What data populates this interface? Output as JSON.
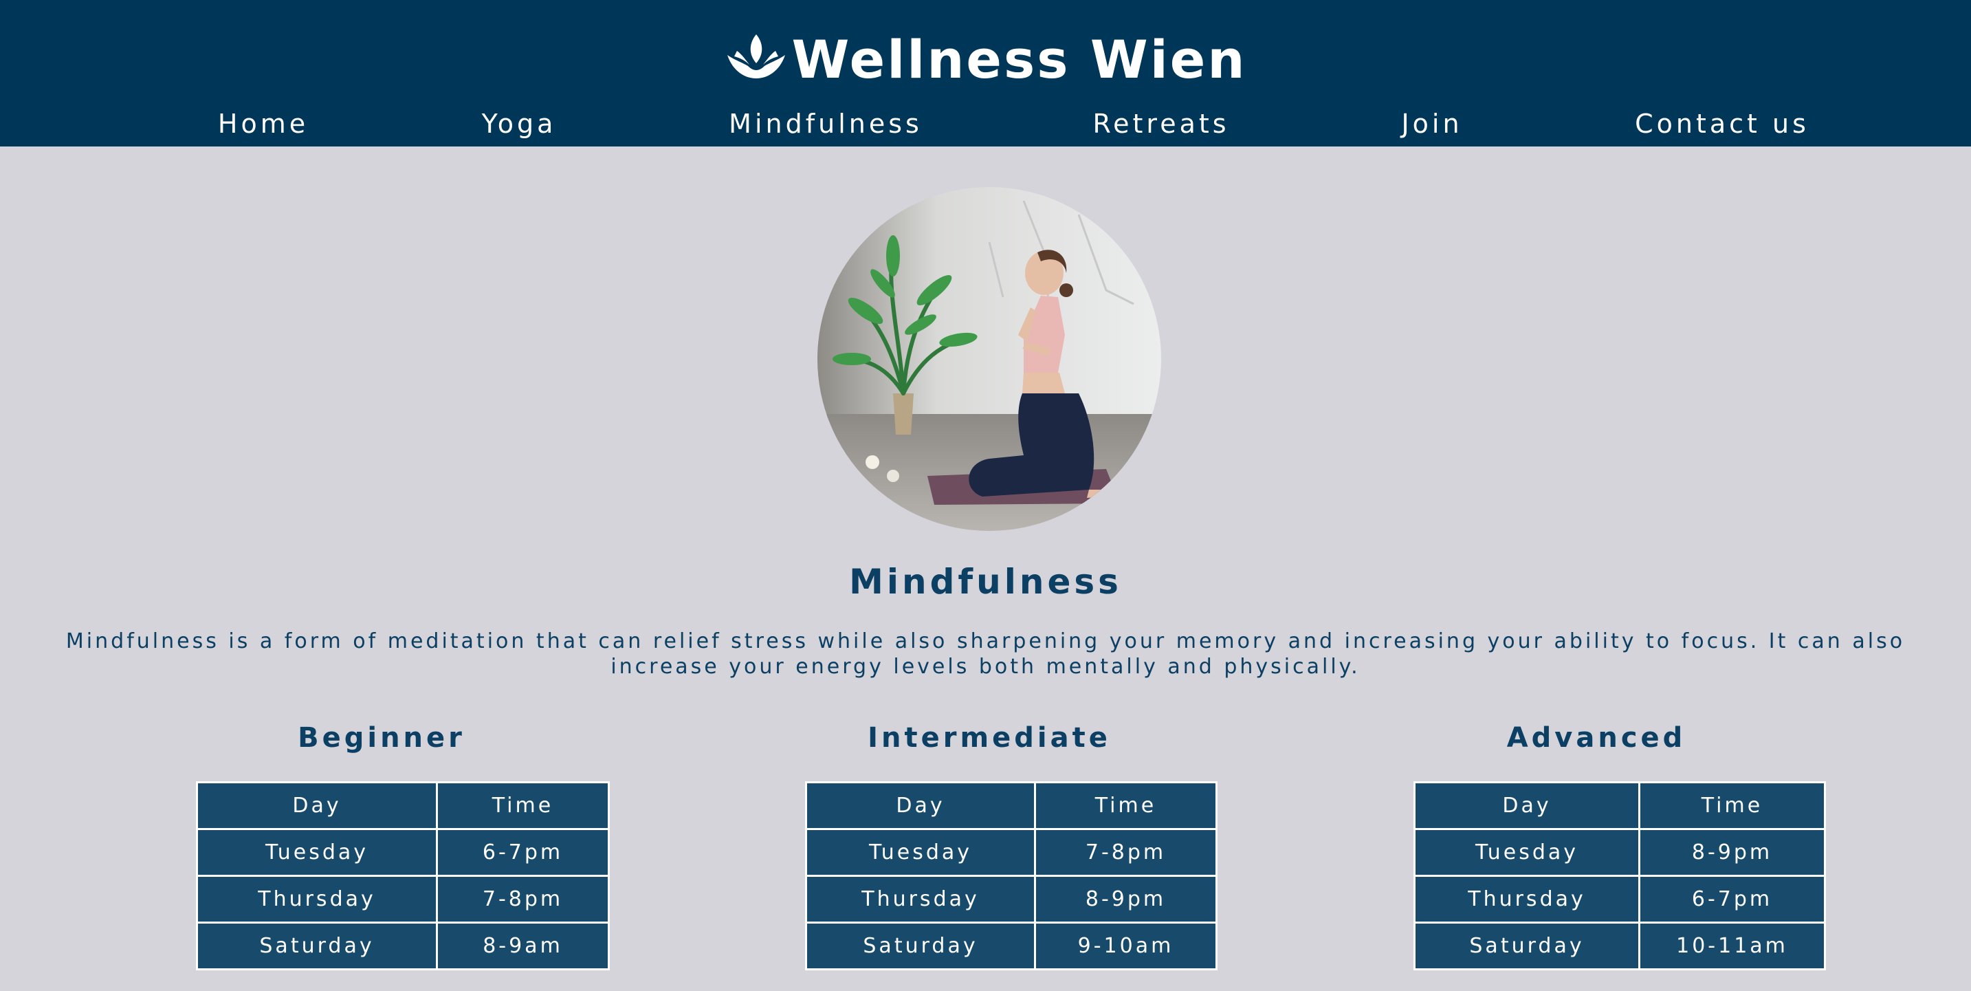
{
  "brand": {
    "title": "Wellness Wien",
    "logo_icon": "lotus-icon"
  },
  "nav": {
    "items": [
      {
        "label": "Home"
      },
      {
        "label": "Yoga"
      },
      {
        "label": "Mindfulness"
      },
      {
        "label": "Retreats"
      },
      {
        "label": "Join"
      },
      {
        "label": "Contact us"
      }
    ]
  },
  "hero": {
    "image": "woman-meditating-photo"
  },
  "main": {
    "title": "Mindfulness",
    "intro": "Mindfulness is a form of meditation that can relief stress while also sharpening your memory and increasing your ability to focus. It can also increase your energy levels both mentally and physically."
  },
  "schedules": [
    {
      "level": "Beginner",
      "headers": [
        "Day",
        "Time"
      ],
      "rows": [
        [
          "Tuesday",
          "6-7pm"
        ],
        [
          "Thursday",
          "7-8pm"
        ],
        [
          "Saturday",
          "8-9am"
        ]
      ]
    },
    {
      "level": "Intermediate",
      "headers": [
        "Day",
        "Time"
      ],
      "rows": [
        [
          "Tuesday",
          "7-8pm"
        ],
        [
          "Thursday",
          "8-9pm"
        ],
        [
          "Saturday",
          "9-10am"
        ]
      ]
    },
    {
      "level": "Advanced",
      "headers": [
        "Day",
        "Time"
      ],
      "rows": [
        [
          "Tuesday",
          "8-9pm"
        ],
        [
          "Thursday",
          "6-7pm"
        ],
        [
          "Saturday",
          "10-11am"
        ]
      ]
    }
  ],
  "colors": {
    "header_bg": "#003658",
    "page_bg": "#d5d4da",
    "table_bg": "#174a6b",
    "text": "#0b3f63"
  }
}
